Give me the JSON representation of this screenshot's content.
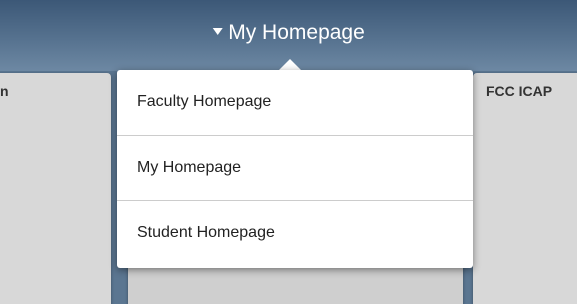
{
  "header": {
    "page_switch_label": "My Homepage"
  },
  "tiles": [
    {
      "title": "n"
    },
    {
      "title": ""
    },
    {
      "title": "FCC ICAP"
    }
  ],
  "dropdown": {
    "items": [
      {
        "label": "Faculty Homepage"
      },
      {
        "label": "My Homepage"
      },
      {
        "label": "Student Homepage"
      }
    ]
  },
  "colors": {
    "header_top": "#3c5877",
    "header_bottom": "#6d88a3",
    "tile_bg": "#d8d8d8",
    "dropdown_bg": "#ffffff"
  }
}
